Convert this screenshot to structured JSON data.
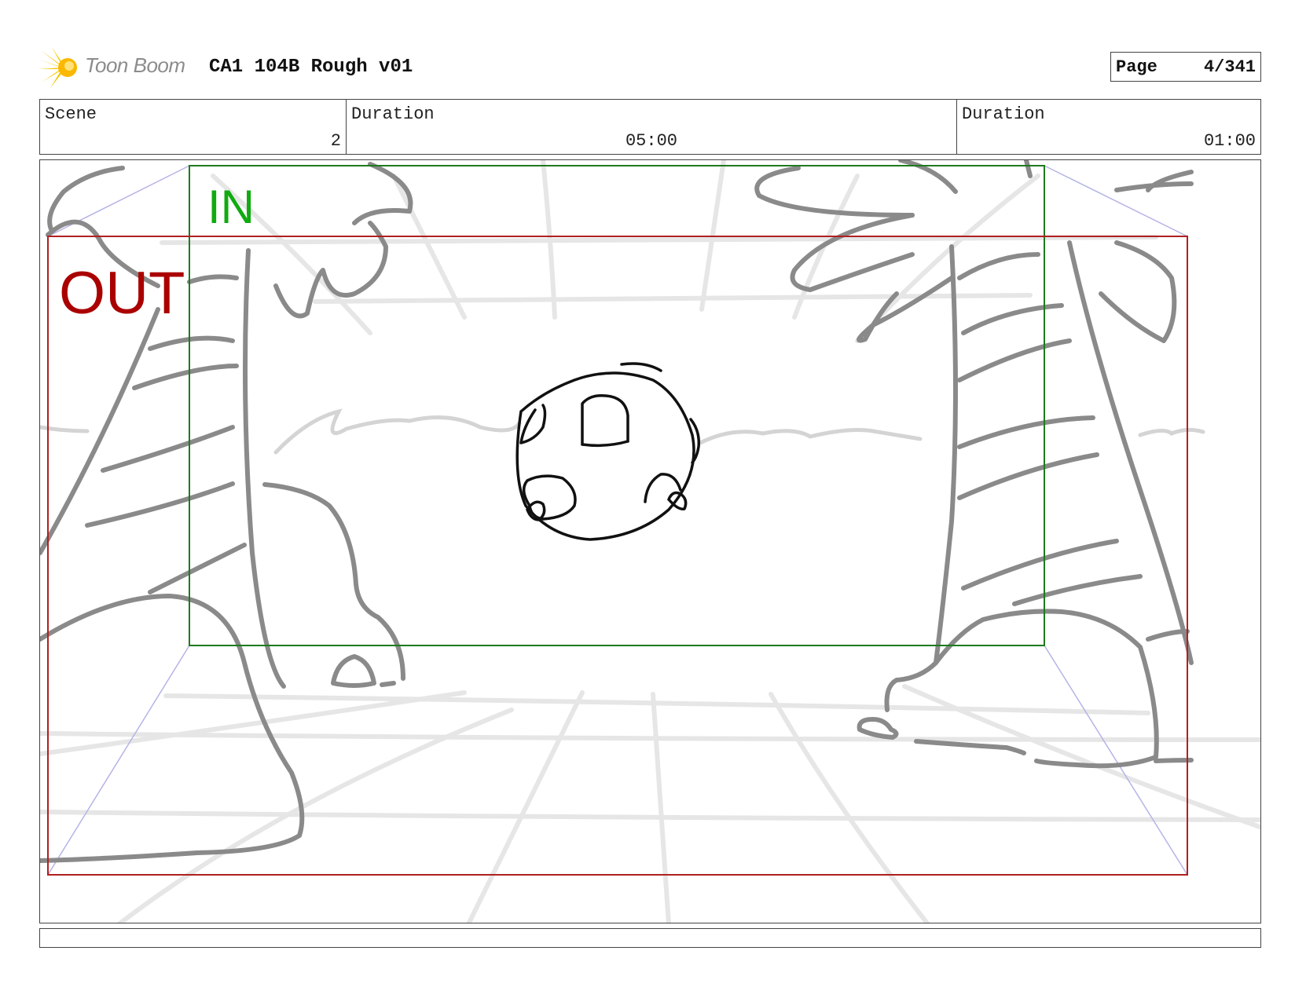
{
  "header": {
    "logo_text": "Toon Boom",
    "project_title": "CA1 104B Rough v01",
    "page_label": "Page",
    "page_value": "4/341"
  },
  "info": {
    "scene_label": "Scene",
    "scene_value": "2",
    "duration_label": "Duration",
    "duration_value": "05:00",
    "duration2_label": "Duration",
    "duration2_value": "01:00"
  },
  "panel": {
    "in_label": "IN",
    "out_label": "OUT",
    "in_color": "#11aa11",
    "out_color": "#aa0000",
    "sketch_color": "#8a8a8a",
    "guide_color": "#e4e4e4",
    "character_color": "#111111"
  },
  "caption": {
    "text": ""
  }
}
